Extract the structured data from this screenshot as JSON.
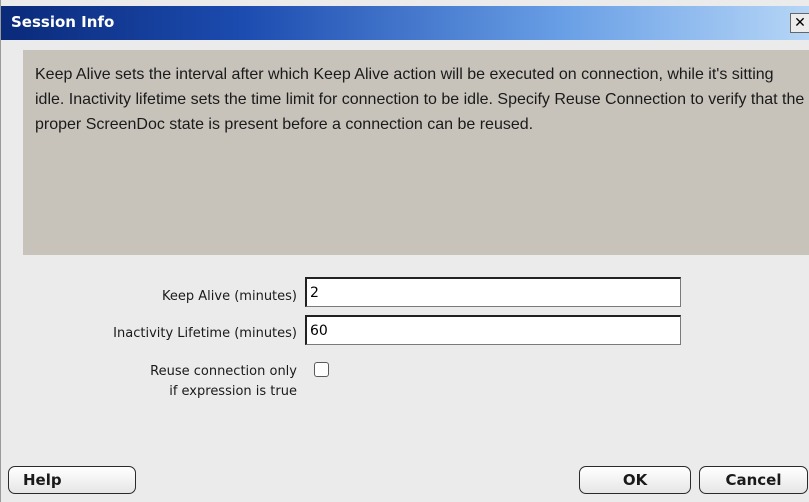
{
  "dialog": {
    "title": "Session Info",
    "close_symbol": "✕"
  },
  "info": {
    "text": "Keep Alive sets the interval after which Keep Alive action will be executed on connection, while it's sitting idle. Inactivity lifetime sets the time limit for connection to be idle. Specify Reuse Connection to verify that the proper ScreenDoc state is present before a connection can be reused."
  },
  "fields": {
    "keep_alive": {
      "label": "Keep Alive (minutes)",
      "value": "2"
    },
    "inactivity": {
      "label": "Inactivity Lifetime (minutes)",
      "value": "60"
    },
    "reuse": {
      "label_line1": "Reuse connection only",
      "label_line2": "if expression is true",
      "checked": false
    }
  },
  "buttons": {
    "help": "Help",
    "ok": "OK",
    "cancel": "Cancel"
  }
}
